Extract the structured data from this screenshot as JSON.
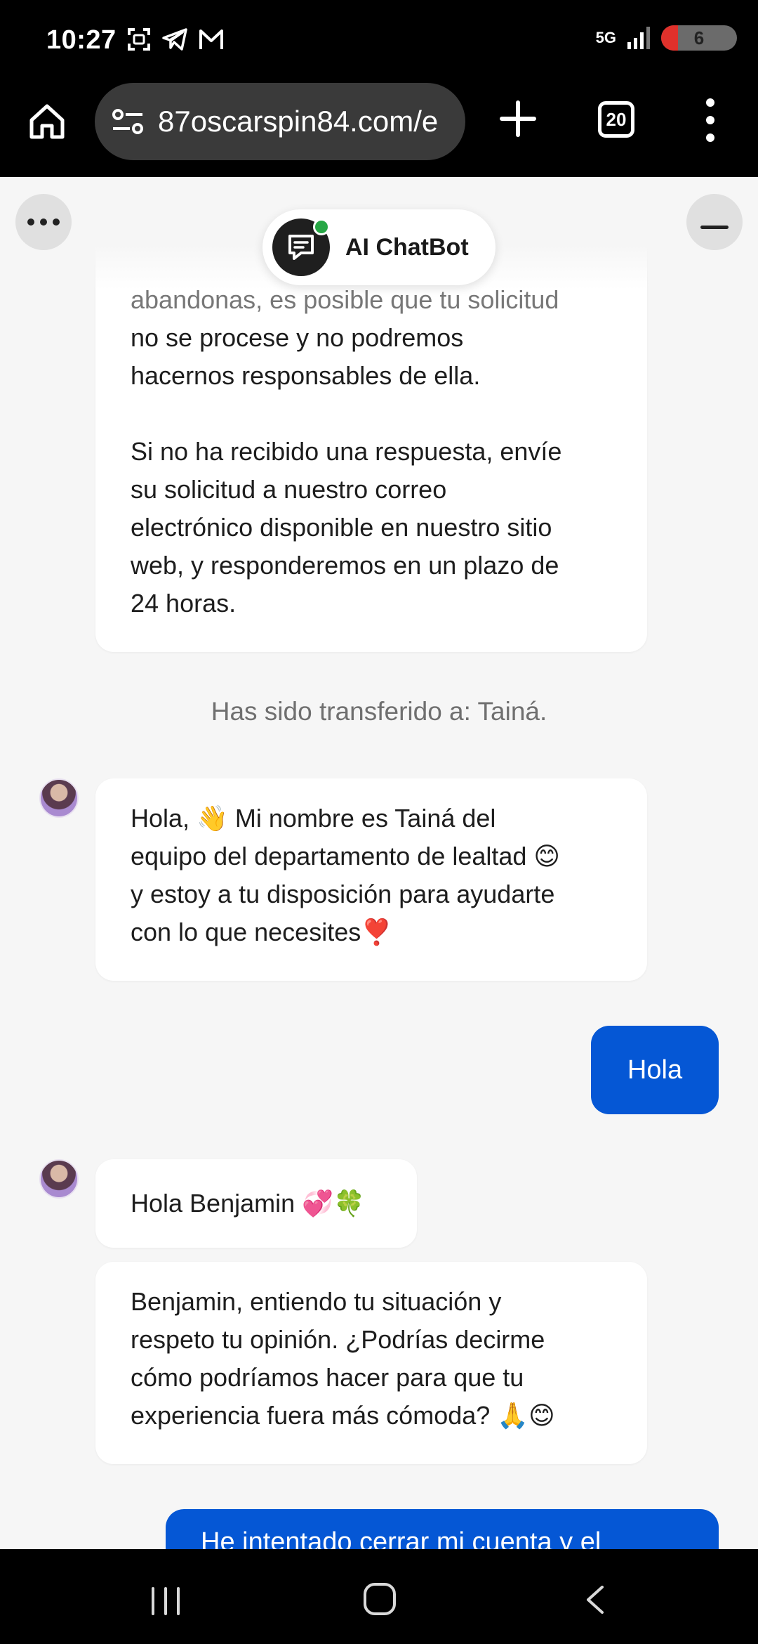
{
  "status_bar": {
    "time": "10:27",
    "network": "5G",
    "battery": "6"
  },
  "browser": {
    "url": "87oscarspin84.com/e",
    "tab_count": "20"
  },
  "chat": {
    "bot_name": "AI ChatBot",
    "messages": [
      {
        "from": "bot",
        "lines_muted": "abandonas, es posible que tu solicitud",
        "text": "no se procese y no podremos\nhacernos responsables de ella.\n\nSi no ha recibido una respuesta, envíe\nsu solicitud a nuestro correo\nelectrónico disponible en nuestro sitio\nweb, y responderemos en un plazo de\n24 horas."
      },
      {
        "from": "system",
        "text": "Has sido transferido a: Tainá."
      },
      {
        "from": "agent",
        "text": "Hola, 👋 Mi nombre es Tainá del\nequipo del departamento de lealtad 😊\ny estoy a tu disposición para ayudarte\ncon lo que necesites❣️"
      },
      {
        "from": "user",
        "text": "Hola"
      },
      {
        "from": "agent",
        "text": "Hola Benjamin 💞🍀"
      },
      {
        "from": "agent",
        "text": "Benjamin, entiendo tu situación y\nrespeto tu opinión. ¿Podrías decirme\ncómo podríamos hacer para que tu\nexperiencia fuera más cómoda? 🙏😊"
      },
      {
        "from": "user",
        "text": "He intentado cerrar mi cuenta y el"
      }
    ]
  },
  "colors": {
    "user_bubble": "#0557d5",
    "chat_background": "#f6f6f6",
    "online_indicator": "#27a745"
  }
}
